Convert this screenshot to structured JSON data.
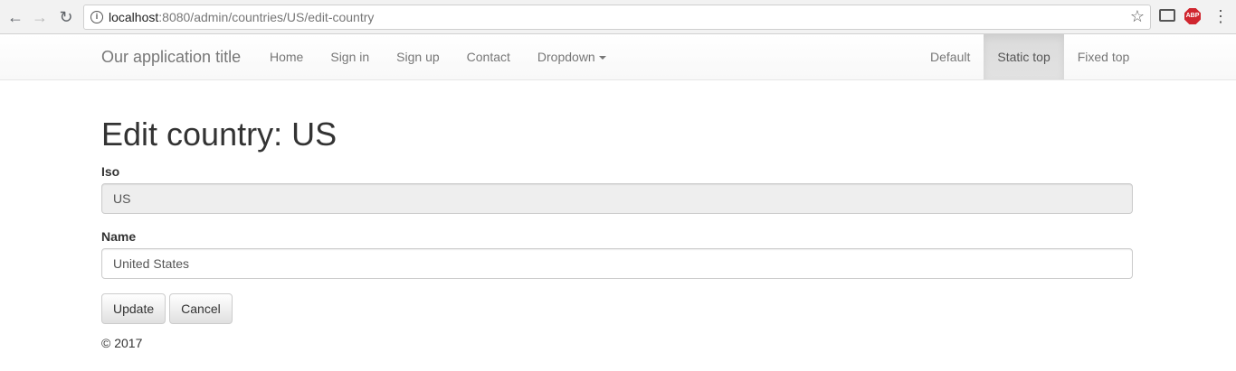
{
  "browser": {
    "url_host": "localhost",
    "url_rest": ":8080/admin/countries/US/edit-country",
    "abp_label": "ABP"
  },
  "navbar": {
    "brand": "Our application title",
    "left_items": [
      "Home",
      "Sign in",
      "Sign up",
      "Contact",
      "Dropdown"
    ],
    "right_items": [
      "Default",
      "Static top",
      "Fixed top"
    ],
    "active_right": "Static top"
  },
  "page": {
    "title": "Edit country: US",
    "iso_label": "Iso",
    "iso_value": "US",
    "name_label": "Name",
    "name_value": "United States",
    "update_label": "Update",
    "cancel_label": "Cancel",
    "footer": "© 2017"
  }
}
